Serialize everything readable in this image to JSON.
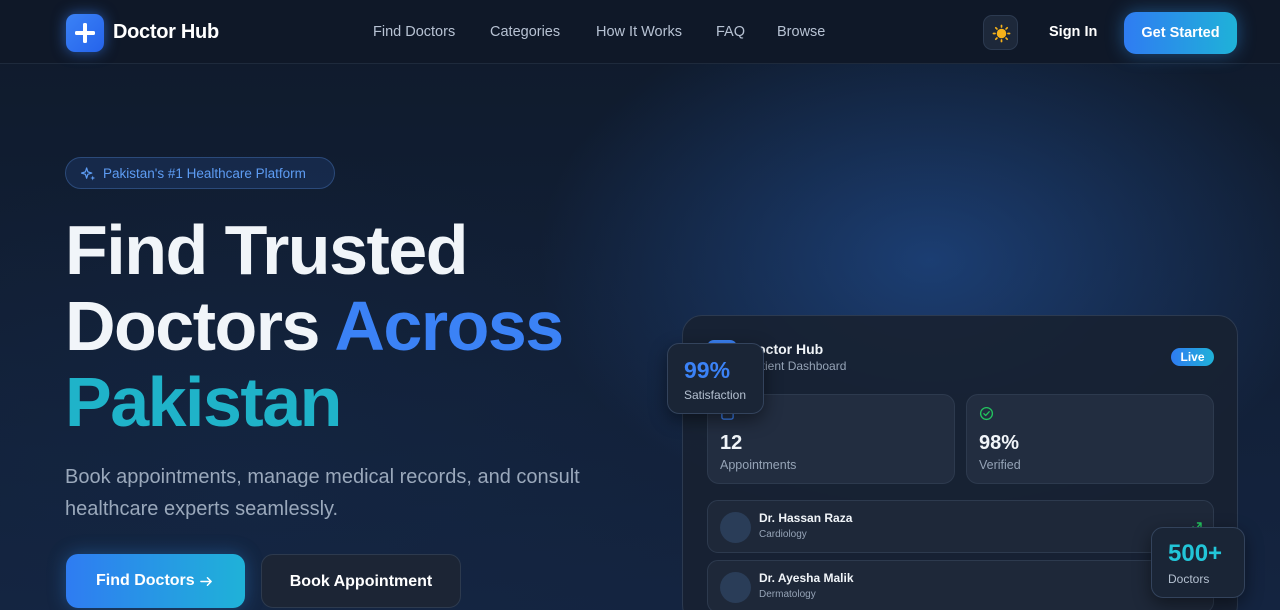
{
  "brand": {
    "name": "Doctor Hub",
    "logo_icon": "plus-icon",
    "accent": "#3b82f6",
    "accent_end": "#1fb2d8"
  },
  "nav": {
    "links": [
      "Find Doctors",
      "Categories",
      "How It Works",
      "FAQ",
      "Browse"
    ],
    "theme_icon": "sun-icon",
    "sign_in": "Sign In",
    "get_started": "Get Started"
  },
  "hero": {
    "badge": "Pakistan's #1 Healthcare Platform",
    "badge_icon": "sparkles-icon",
    "title_line1": "Find Trusted",
    "title_line2_a": "Doctors ",
    "title_line2_b": "Across",
    "title_line3": "Pakistan",
    "lead": "Book appointments, manage medical records, and consult healthcare experts seamlessly.",
    "cta_primary": "Find Doctors",
    "cta_primary_icon": "arrow-right-icon",
    "cta_secondary": "Book Appointment"
  },
  "dashboard": {
    "title": "Doctor Hub",
    "subtitle": "Patient Dashboard",
    "live": "Live",
    "stats": [
      {
        "icon": "calendar-icon",
        "value": "12",
        "label": "Appointments"
      },
      {
        "icon": "check-circle-icon",
        "value": "98%",
        "label": "Verified"
      }
    ],
    "doctors": [
      {
        "name": "Dr. Hassan Raza",
        "specialty": "Cardiology"
      },
      {
        "name": "Dr. Ayesha Malik",
        "specialty": "Dermatology"
      }
    ]
  },
  "floats": {
    "satisfaction": {
      "value": "99%",
      "label": "Satisfaction"
    },
    "doctors": {
      "value": "500+",
      "label": "Doctors"
    }
  }
}
